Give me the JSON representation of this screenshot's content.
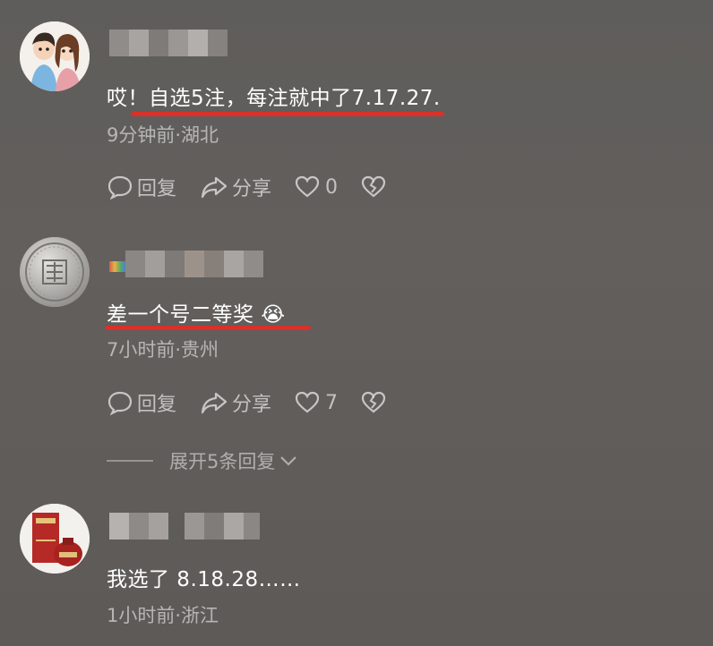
{
  "comments": [
    {
      "text": "哎！自选5注，每注就中了7.17.27.",
      "meta": "9分钟前·湖北",
      "reply_label": "回复",
      "share_label": "分享",
      "like_count": "0"
    },
    {
      "text": "差一个号二等奖 😭",
      "meta": "7小时前·贵州",
      "reply_label": "回复",
      "share_label": "分享",
      "like_count": "7"
    },
    {
      "text": "我选了 8.18.28……",
      "meta": "1小时前·浙江"
    }
  ],
  "expand_replies_label": "展开5条回复",
  "icons": {
    "reply": "comment-bubble-icon",
    "share": "share-arrow-icon",
    "like": "heart-icon",
    "dislike": "broken-heart-icon",
    "expand": "chevron-down-icon"
  },
  "colors": {
    "underline": "#d9302a",
    "background": "#5f5d5b"
  }
}
